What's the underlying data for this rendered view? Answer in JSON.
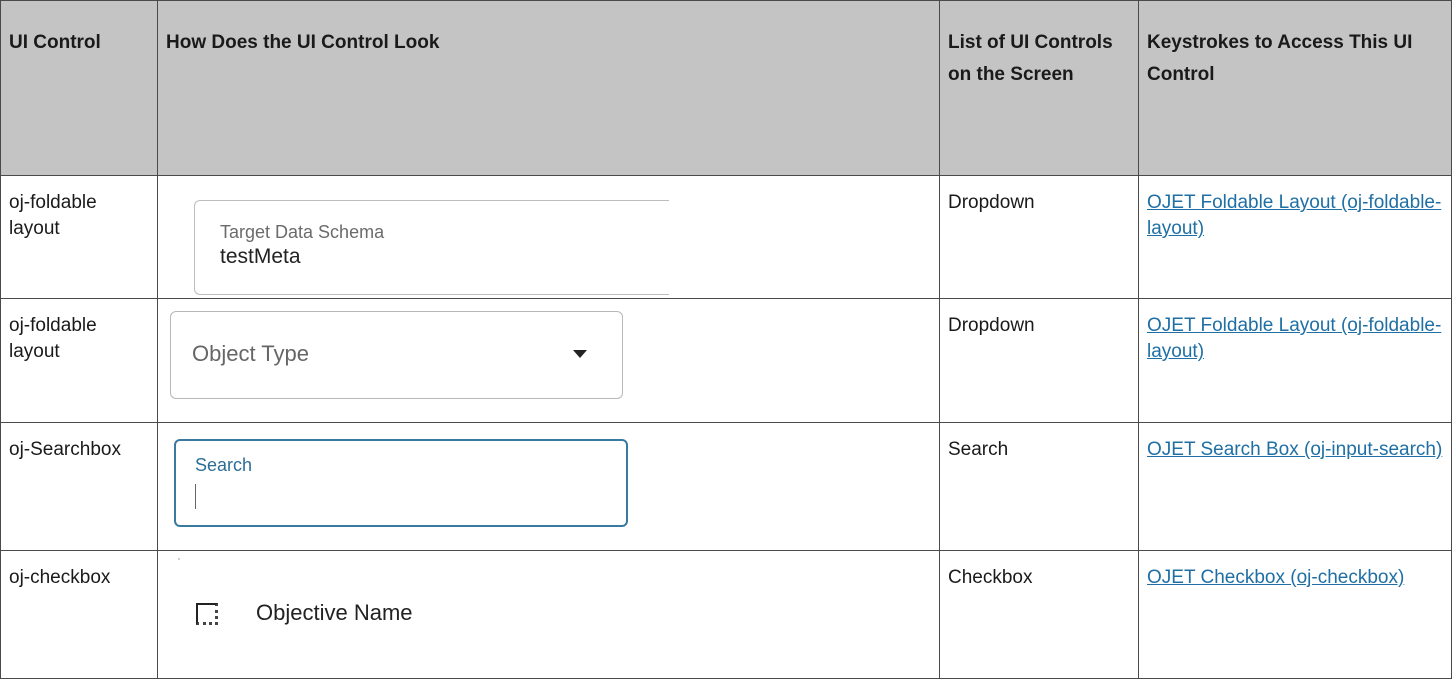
{
  "table": {
    "headers": [
      "UI Control",
      "How Does the UI Control Look",
      "List of UI Controls on the Screen",
      "Keystrokes to Access This UI Control"
    ],
    "rows": [
      {
        "control": "oj-foldable layout",
        "look": {
          "label": "Target Data Schema",
          "value": "testMeta"
        },
        "list": "Dropdown",
        "link": "OJET Foldable Layout (oj-foldable-layout)"
      },
      {
        "control": "oj-foldable layout",
        "look": {
          "value": "Object Type",
          "icon": "dropdown-caret-icon"
        },
        "list": "Dropdown",
        "link": "OJET Foldable Layout (oj-foldable-layout)"
      },
      {
        "control": "oj-Searchbox",
        "look": {
          "label": "Search"
        },
        "list": "Search",
        "link": "OJET Search Box (oj-input-search)"
      },
      {
        "control": "oj-checkbox",
        "look": {
          "label": "Objective Name",
          "icon": "checkbox-icon"
        },
        "list": "Checkbox",
        "link": "OJET Checkbox (oj-checkbox)"
      }
    ]
  },
  "colors": {
    "header_bg": "#c4c4c4",
    "border": "#4a4a4a",
    "link": "#1f6fa5",
    "search_focus_border": "#3a7aa0",
    "search_label": "#2b6d97"
  }
}
